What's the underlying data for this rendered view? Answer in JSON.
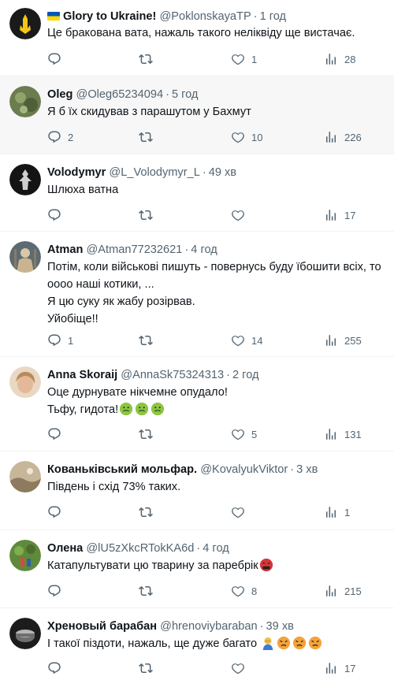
{
  "tweets": [
    {
      "display_name": "Glory to Ukraine!",
      "handle": "@PoklonskayaTP",
      "time": "1 год",
      "lines": [
        "Це бракована вата, нажаль такого неліквіду ще вистачає."
      ],
      "replies": "",
      "retweets": "",
      "likes": "1",
      "views": "28"
    },
    {
      "display_name": "Oleg",
      "handle": "@Oleg65234094",
      "time": "5 год",
      "lines": [
        "Я б їх скидував з парашутом у Бахмут"
      ],
      "replies": "2",
      "retweets": "",
      "likes": "10",
      "views": "226"
    },
    {
      "display_name": "Volodymyr",
      "handle": "@L_Volodymyr_L",
      "time": "49 хв",
      "lines": [
        "Шлюха ватна"
      ],
      "replies": "",
      "retweets": "",
      "likes": "",
      "views": "17"
    },
    {
      "display_name": "Atman",
      "handle": "@Atman77232621",
      "time": "4 год",
      "lines": [
        "Потім, коли військові пишуть - повернусь буду їбошити всіх, то",
        "оооо наші котики, ...",
        "Я цю суку як жабу розірвав.",
        "Уйобіще!!"
      ],
      "replies": "1",
      "retweets": "",
      "likes": "14",
      "views": "255"
    },
    {
      "display_name": "Anna Skoraij",
      "handle": "@AnnaSk75324313",
      "time": "2 год",
      "lines": [
        "Оце дурнувате нікчемне опудало!",
        "Тьфу, гидота!"
      ],
      "replies": "",
      "retweets": "",
      "likes": "5",
      "views": "131"
    },
    {
      "display_name": "Кованьківський мольфар.",
      "handle": "@KovalyukViktor",
      "time": "3 хв",
      "lines": [
        "Південь і схід 73% таких."
      ],
      "replies": "",
      "retweets": "",
      "likes": "",
      "views": "1"
    },
    {
      "display_name": "Олена",
      "handle": "@lU5zXkcRTokKA6d",
      "time": "4 год",
      "lines": [
        "Катапультувати цю тварину за паребрік"
      ],
      "replies": "",
      "retweets": "",
      "likes": "8",
      "views": "215"
    },
    {
      "display_name": "Хреновый барабан",
      "handle": "@hrenoviybaraban",
      "time": "39 хв",
      "lines": [
        "І такої піздоти, нажаль, ще дуже багато"
      ],
      "replies": "",
      "retweets": "",
      "likes": "",
      "views": "17"
    }
  ],
  "icons": {
    "reply": "reply-icon",
    "retweet": "retweet-icon",
    "like": "like-icon",
    "views": "views-icon"
  },
  "colors": {
    "text": "#0f1419",
    "secondary": "#536471",
    "highlight_bg": "#f7f7f7",
    "divider": "#eff3f4"
  }
}
